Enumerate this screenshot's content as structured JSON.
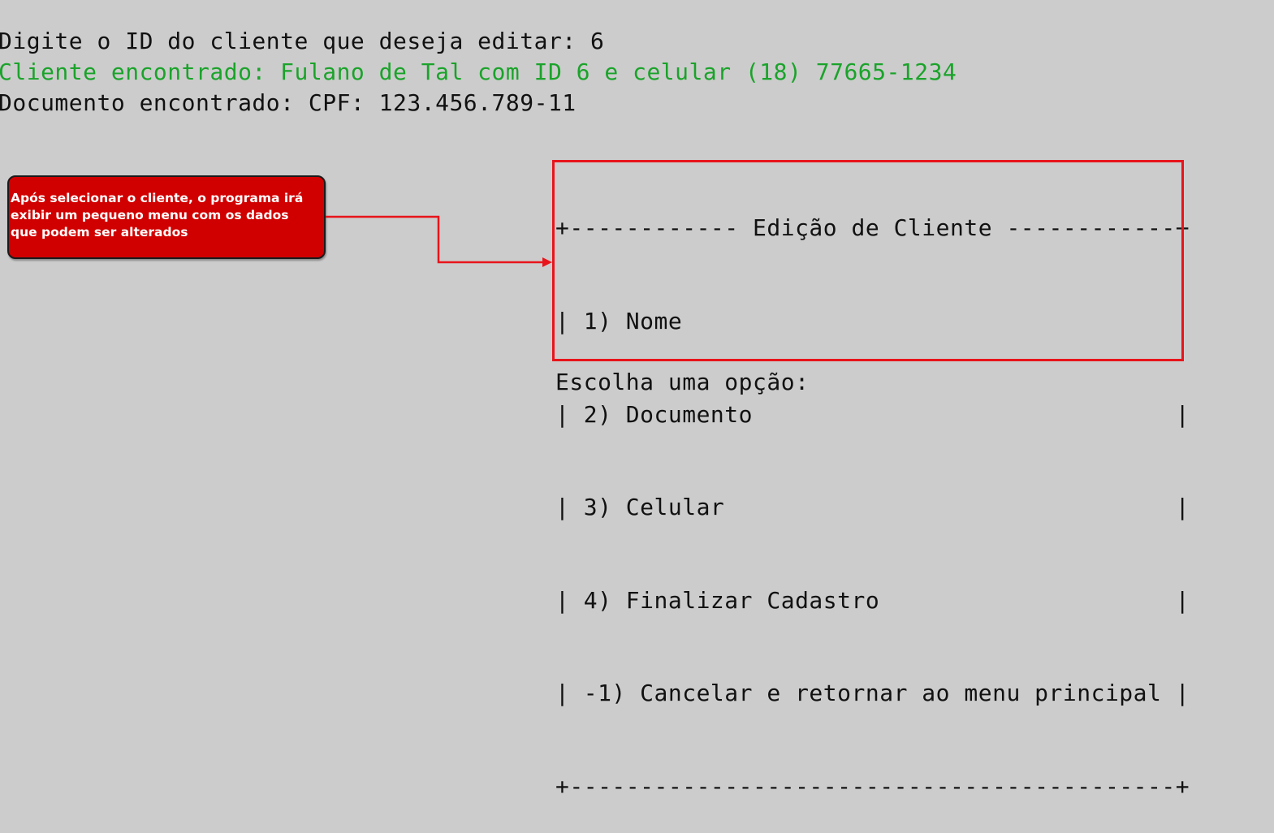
{
  "terminal": {
    "line1": "Digite o ID do cliente que deseja editar: 6",
    "line2": "Cliente encontrado: Fulano de Tal com ID 6 e celular (18) 77665-1234",
    "line3": "Documento encontrado: CPF: 123.456.789-11"
  },
  "menu": {
    "rows": [
      "+------------ Edição de Cliente ------------+",
      "| 1) Nome                                   |",
      "| 2) Documento                              |",
      "| 3) Celular                                |",
      "| 4) Finalizar Cadastro                     |",
      "| -1) Cancelar e retornar ao menu principal |",
      "+-------------------------------------------+"
    ]
  },
  "prompt": "Escolha uma opção:",
  "callout": {
    "text": "Após selecionar o cliente, o programa irá exibir um pequeno menu com os dados que podem ser alterados"
  },
  "colors": {
    "background": "#cccccc",
    "text": "#111111",
    "found_text": "#1aa32a",
    "highlight_border": "#e8141b",
    "callout_fill": "#d10000",
    "callout_text": "#ffffff"
  }
}
